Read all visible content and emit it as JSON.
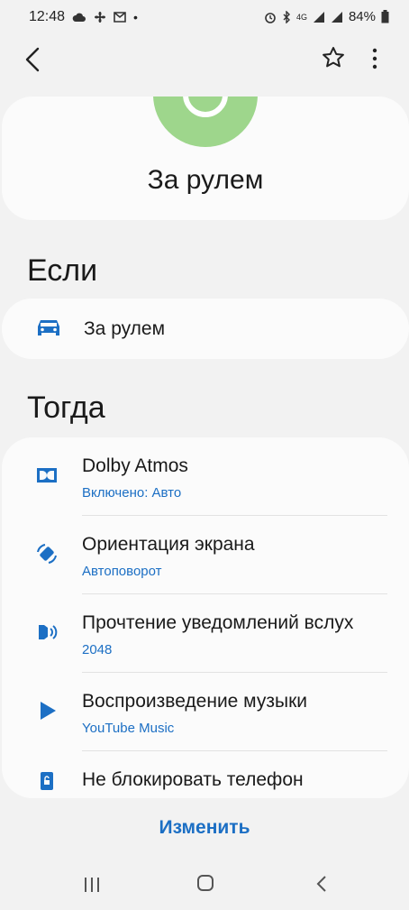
{
  "status": {
    "time": "12:48",
    "network": "4G",
    "battery": "84%"
  },
  "header": {
    "title": "За рулем"
  },
  "if_section": {
    "title": "Если",
    "condition": "За рулем"
  },
  "then_section": {
    "title": "Тогда",
    "items": [
      {
        "title": "Dolby Atmos",
        "subtitle": "Включено: Авто",
        "icon": "dolby-icon"
      },
      {
        "title": "Ориентация экрана",
        "subtitle": "Автоповорот",
        "icon": "rotate-icon"
      },
      {
        "title": "Прочтение уведомлений вслух",
        "subtitle": "2048",
        "icon": "speaker-icon"
      },
      {
        "title": "Воспроизведение музыки",
        "subtitle": "YouTube Music",
        "icon": "play-icon"
      },
      {
        "title": "Не блокировать телефон",
        "subtitle": "",
        "icon": "lock-icon"
      }
    ]
  },
  "actions": {
    "edit": "Изменить"
  },
  "colors": {
    "accent": "#1c6fc4",
    "logo_green": "#9ed68c",
    "background": "#f2f2f2",
    "card": "#fbfbfb"
  }
}
